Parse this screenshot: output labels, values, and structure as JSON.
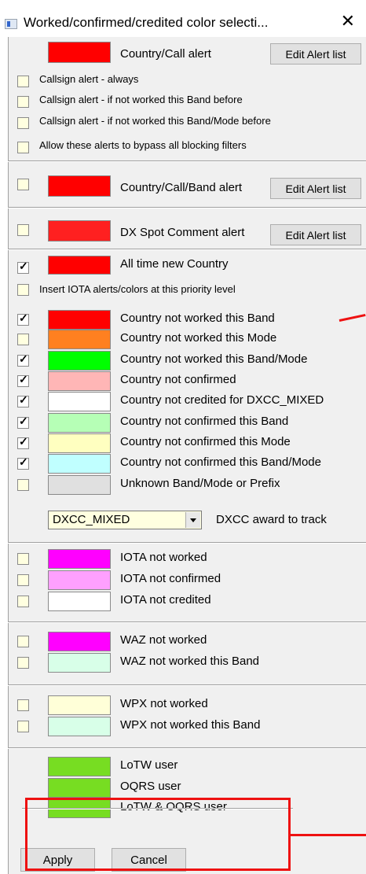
{
  "window": {
    "title": "Worked/confirmed/credited color selecti...",
    "close": "✕"
  },
  "section1": {
    "alert_swatch_color": "#ff0000",
    "alert_label": "Country/Call alert",
    "edit_button": "Edit Alert list",
    "options": [
      {
        "label": "Callsign alert - always",
        "checked": false
      },
      {
        "label": "Callsign alert - if not worked this Band before",
        "checked": false
      },
      {
        "label": "Callsign alert - if not worked this Band/Mode before",
        "checked": false
      },
      {
        "label": "Allow these alerts to bypass all blocking filters",
        "checked": false
      }
    ]
  },
  "section2": {
    "swatch_color": "#ff0000",
    "label": "Country/Call/Band alert",
    "edit_button": "Edit Alert list",
    "checked": false
  },
  "section3": {
    "swatch_color": "#ff2020",
    "label": "DX Spot Comment alert",
    "edit_button": "Edit Alert list",
    "checked": false
  },
  "section4": {
    "all_time": {
      "label": "All time new Country",
      "color": "#ff0000",
      "checked": true
    },
    "insert_iota": {
      "label": "Insert IOTA alerts/colors at this priority level",
      "checked": false
    },
    "rows": [
      {
        "label": "Country not worked this Band",
        "color": "#ff0000",
        "checked": true
      },
      {
        "label": "Country not worked this Mode",
        "color": "#ff8020",
        "checked": false
      },
      {
        "label": "Country not worked this Band/Mode",
        "color": "#00ff00",
        "checked": true
      },
      {
        "label": "Country not confirmed",
        "color": "#ffb6b6",
        "checked": true
      },
      {
        "label": "Country not credited for DXCC_MIXED",
        "color": "#ffffff",
        "checked": true
      },
      {
        "label": "Country not confirmed this Band",
        "color": "#b6ffb6",
        "checked": true
      },
      {
        "label": "Country not confirmed this Mode",
        "color": "#ffffc0",
        "checked": true
      },
      {
        "label": "Country not confirmed this Band/Mode",
        "color": "#c0ffff",
        "checked": true
      },
      {
        "label": "Unknown Band/Mode or Prefix",
        "color": "#e0e0e0",
        "checked": false
      }
    ],
    "award_select": {
      "value": "DXCC_MIXED",
      "label": "DXCC award to track"
    }
  },
  "section_iota": {
    "rows": [
      {
        "label": "IOTA not worked",
        "color": "#ff00ff",
        "checked": false
      },
      {
        "label": "IOTA not confirmed",
        "color": "#ffa0ff",
        "checked": false
      },
      {
        "label": "IOTA not credited",
        "color": "#ffffff",
        "checked": false
      }
    ]
  },
  "section_waz": {
    "rows": [
      {
        "label": "WAZ not worked",
        "color": "#ff00ff",
        "checked": false
      },
      {
        "label": "WAZ not worked this Band",
        "color": "#d8ffe8",
        "checked": false
      }
    ]
  },
  "section_wpx": {
    "rows": [
      {
        "label": "WPX not worked",
        "color": "#ffffd8",
        "checked": false
      },
      {
        "label": "WPX not worked this Band",
        "color": "#d8ffe8",
        "checked": false
      }
    ]
  },
  "section_users": {
    "rows": [
      {
        "label": "LoTW user",
        "color": "#77dd22"
      },
      {
        "label": "OQRS user",
        "color": "#77dd22"
      },
      {
        "label": "LoTW & OQRS user",
        "color": "#77dd22"
      }
    ]
  },
  "footer": {
    "apply": "Apply",
    "cancel": "Cancel"
  },
  "annotation_color": "#ee1111"
}
